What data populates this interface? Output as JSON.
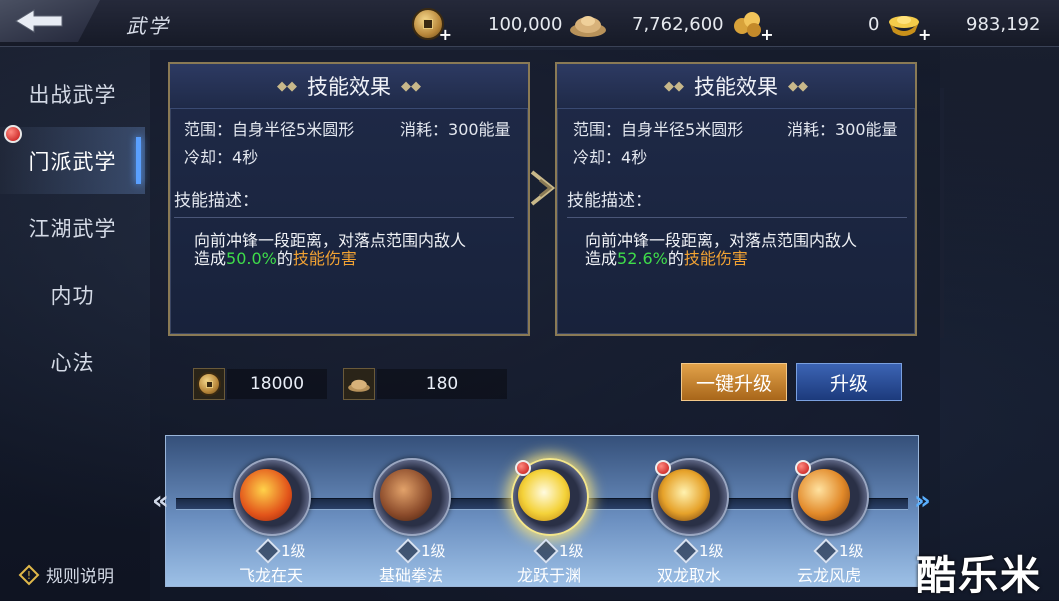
{
  "header": {
    "title": "武学",
    "resources": [
      {
        "name": "copper-coin",
        "value": ""
      },
      {
        "name": "silver-pile",
        "value": "100,000"
      },
      {
        "name": "gold-nugget",
        "value": "7,762,600"
      },
      {
        "name": "gold-ingot",
        "value": "0"
      },
      {
        "name": "total",
        "value": "983,192"
      }
    ]
  },
  "sidebar": {
    "items": [
      {
        "label": "出战武学"
      },
      {
        "label": "门派武学"
      },
      {
        "label": "江湖武学"
      },
      {
        "label": "内功"
      },
      {
        "label": "心法"
      }
    ],
    "rules_label": "规则说明"
  },
  "cards": [
    {
      "header": "技能效果",
      "range_label": "范围：",
      "range_value": "自身半径5米圆形",
      "cost_label": "消耗：",
      "cost_value": "300能量",
      "cooldown_label": "冷却：",
      "cooldown_value": "4秒",
      "desc_title": "技能描述：",
      "desc_a": "向前冲锋一段距离，对落点范围内敌人",
      "desc_b": "造成",
      "desc_pct": "50.0%",
      "desc_c": "的",
      "desc_dmg": "技能伤害"
    },
    {
      "header": "技能效果",
      "range_label": "范围：",
      "range_value": "自身半径5米圆形",
      "cost_label": "消耗：",
      "cost_value": "300能量",
      "cooldown_label": "冷却：",
      "cooldown_value": "4秒",
      "desc_title": "技能描述：",
      "desc_a": "向前冲锋一段距离，对落点范围内敌人",
      "desc_b": "造成",
      "desc_pct": "52.6%",
      "desc_c": "的",
      "desc_dmg": "技能伤害"
    }
  ],
  "upgrade_cost": {
    "coin": "18000",
    "silver": "180"
  },
  "buttons": {
    "one_click": "一键升级",
    "upgrade": "升级"
  },
  "skills": [
    {
      "name": "飞龙在天",
      "level": "1级"
    },
    {
      "name": "基础拳法",
      "level": "1级"
    },
    {
      "name": "龙跃于渊",
      "level": "1级"
    },
    {
      "name": "双龙取水",
      "level": "1级"
    },
    {
      "name": "云龙风虎",
      "level": "1级"
    }
  ],
  "watermark": "酷乐米",
  "colors": {
    "highlight_green": "#3fdc4a",
    "highlight_orange": "#f2a233",
    "selected_glow": "#f4e68a"
  }
}
